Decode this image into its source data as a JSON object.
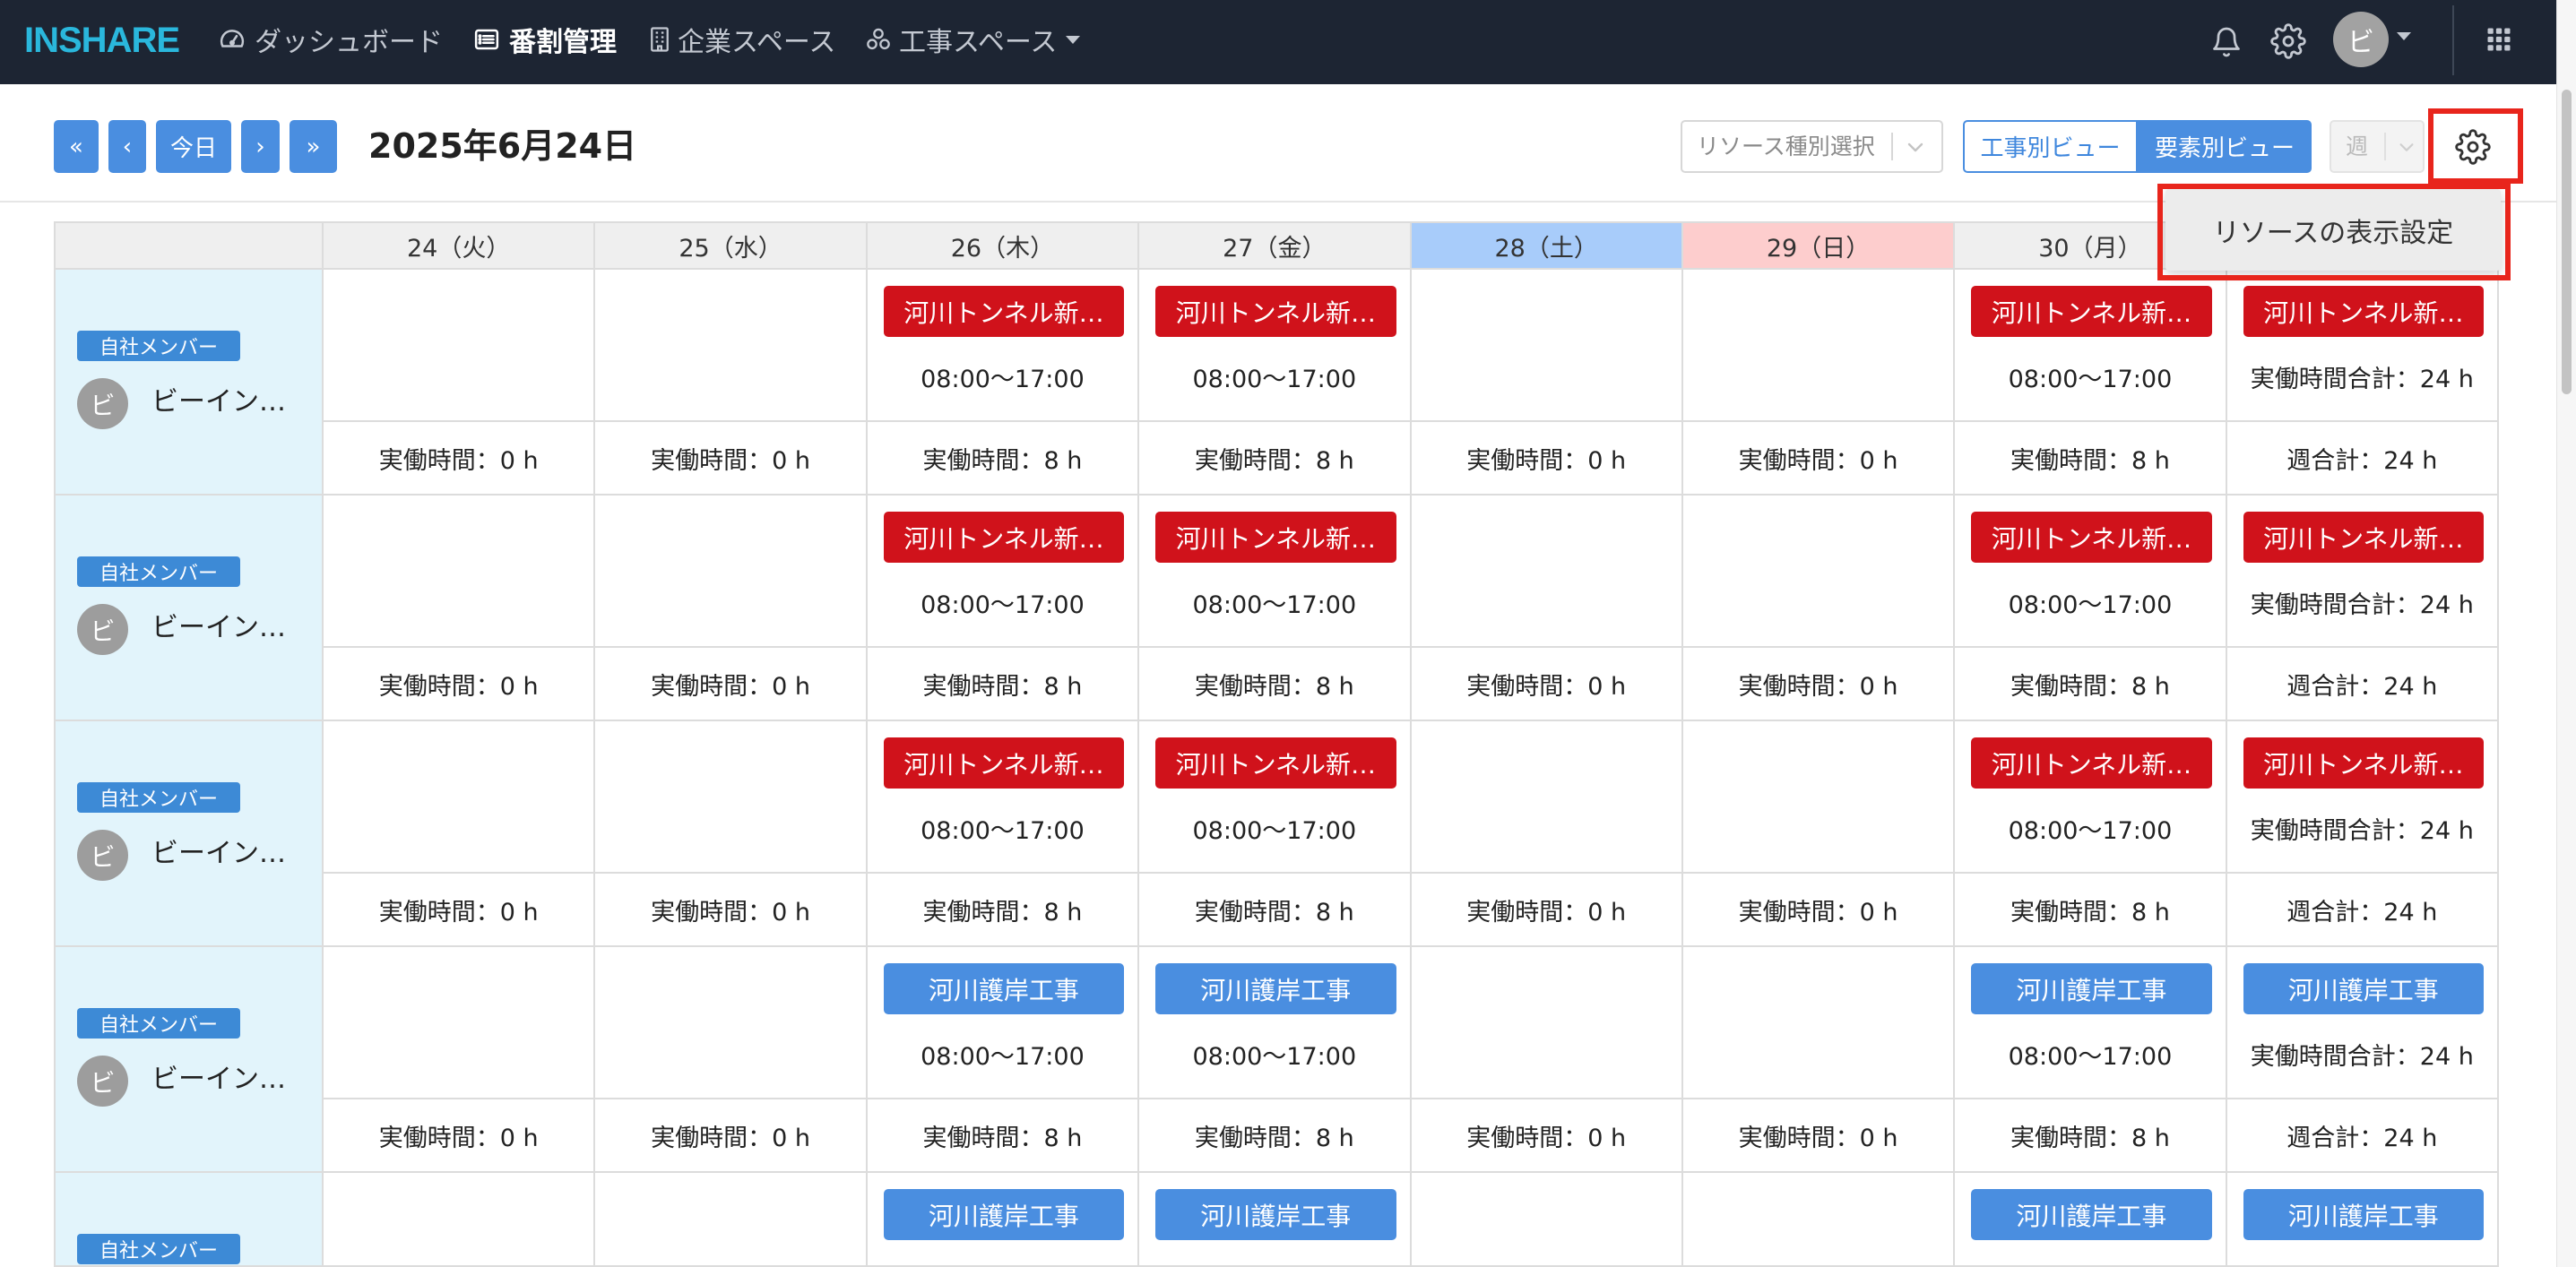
{
  "nav": {
    "logo": "INSHARE",
    "items": [
      {
        "label": "ダッシュボード",
        "icon": "dashboard-icon"
      },
      {
        "label": "番割管理",
        "icon": "list-icon",
        "active": true
      },
      {
        "label": "企業スペース",
        "icon": "building-icon"
      },
      {
        "label": "工事スペース",
        "icon": "network-icon",
        "has_dropdown": true
      }
    ],
    "right_icons": [
      "bell-icon",
      "gear-icon",
      "grid-icon"
    ],
    "avatar": "ビ"
  },
  "toolbar": {
    "first_label": "«",
    "prev_label": "‹",
    "today_label": "今日",
    "next_label": "›",
    "last_label": "»",
    "date_title": "2025年6月24日",
    "resource_type_placeholder": "リソース種別選択",
    "view_tabs": [
      {
        "label": "工事別ビュー",
        "selected": false
      },
      {
        "label": "要素別ビュー",
        "selected": true
      }
    ],
    "period_value": "週",
    "period_disabled": true,
    "settings_icon": "gear-icon"
  },
  "settings_menu": {
    "items": [
      "リソースの表示設定"
    ]
  },
  "colors": {
    "nav_bg": "#1d2533",
    "logo": "#2ab7dc",
    "primary": "#4a8ee0",
    "badge": "#3d8ad6",
    "event_red": "#d0121b",
    "event_blue": "#4a8ee0",
    "saturday": "#a8ccfa",
    "sunday": "#fdcdcd",
    "member_bg": "#e2f4fb",
    "highlight": "#e8251c"
  },
  "schedule": {
    "columns": [
      {
        "label": "24（火）"
      },
      {
        "label": "25（水）"
      },
      {
        "label": "26（木）"
      },
      {
        "label": "27（金）"
      },
      {
        "label": "28（土）",
        "highlight": "saturday"
      },
      {
        "label": "29（日）",
        "highlight": "sunday"
      },
      {
        "label": "30（月）"
      },
      {}
    ],
    "rows": [
      {
        "member": {
          "badge": "自社メンバー",
          "avatar": "ビ",
          "name": "ビーイン…"
        },
        "cells": [
          {
            "total": "実働時間：0 h"
          },
          {
            "total": "実働時間：0 h"
          },
          {
            "event": {
              "label": "河川トンネル新…",
              "color": "#d0121b"
            },
            "detail": "08:00〜17:00",
            "total": "実働時間：8 h"
          },
          {
            "event": {
              "label": "河川トンネル新…",
              "color": "#d0121b"
            },
            "detail": "08:00〜17:00",
            "total": "実働時間：8 h"
          },
          {
            "total": "実働時間：0 h"
          },
          {
            "total": "実働時間：0 h"
          },
          {
            "event": {
              "label": "河川トンネル新…",
              "color": "#d0121b"
            },
            "detail": "08:00〜17:00",
            "total": "実働時間：8 h"
          },
          {
            "event": {
              "label": "河川トンネル新…",
              "color": "#d0121b"
            },
            "detail": "実働時間合計：24 h",
            "total": "週合計：24 h"
          }
        ]
      },
      {
        "member": {
          "badge": "自社メンバー",
          "avatar": "ビ",
          "name": "ビーイン…"
        },
        "cells": [
          {
            "total": "実働時間：0 h"
          },
          {
            "total": "実働時間：0 h"
          },
          {
            "event": {
              "label": "河川トンネル新…",
              "color": "#d0121b"
            },
            "detail": "08:00〜17:00",
            "total": "実働時間：8 h"
          },
          {
            "event": {
              "label": "河川トンネル新…",
              "color": "#d0121b"
            },
            "detail": "08:00〜17:00",
            "total": "実働時間：8 h"
          },
          {
            "total": "実働時間：0 h"
          },
          {
            "total": "実働時間：0 h"
          },
          {
            "event": {
              "label": "河川トンネル新…",
              "color": "#d0121b"
            },
            "detail": "08:00〜17:00",
            "total": "実働時間：8 h"
          },
          {
            "event": {
              "label": "河川トンネル新…",
              "color": "#d0121b"
            },
            "detail": "実働時間合計：24 h",
            "total": "週合計：24 h"
          }
        ]
      },
      {
        "member": {
          "badge": "自社メンバー",
          "avatar": "ビ",
          "name": "ビーイン…"
        },
        "cells": [
          {
            "total": "実働時間：0 h"
          },
          {
            "total": "実働時間：0 h"
          },
          {
            "event": {
              "label": "河川トンネル新…",
              "color": "#d0121b"
            },
            "detail": "08:00〜17:00",
            "total": "実働時間：8 h"
          },
          {
            "event": {
              "label": "河川トンネル新…",
              "color": "#d0121b"
            },
            "detail": "08:00〜17:00",
            "total": "実働時間：8 h"
          },
          {
            "total": "実働時間：0 h"
          },
          {
            "total": "実働時間：0 h"
          },
          {
            "event": {
              "label": "河川トンネル新…",
              "color": "#d0121b"
            },
            "detail": "08:00〜17:00",
            "total": "実働時間：8 h"
          },
          {
            "event": {
              "label": "河川トンネル新…",
              "color": "#d0121b"
            },
            "detail": "実働時間合計：24 h",
            "total": "週合計：24 h"
          }
        ]
      },
      {
        "member": {
          "badge": "自社メンバー",
          "avatar": "ビ",
          "name": "ビーイン…"
        },
        "cells": [
          {
            "total": "実働時間：0 h"
          },
          {
            "total": "実働時間：0 h"
          },
          {
            "event": {
              "label": "河川護岸工事",
              "color": "#4a8ee0"
            },
            "detail": "08:00〜17:00",
            "total": "実働時間：8 h"
          },
          {
            "event": {
              "label": "河川護岸工事",
              "color": "#4a8ee0"
            },
            "detail": "08:00〜17:00",
            "total": "実働時間：8 h"
          },
          {
            "total": "実働時間：0 h"
          },
          {
            "total": "実働時間：0 h"
          },
          {
            "event": {
              "label": "河川護岸工事",
              "color": "#4a8ee0"
            },
            "detail": "08:00〜17:00",
            "total": "実働時間：8 h"
          },
          {
            "event": {
              "label": "河川護岸工事",
              "color": "#4a8ee0"
            },
            "detail": "実働時間合計：24 h",
            "total": "週合計：24 h"
          }
        ]
      },
      {
        "member": {
          "badge": "自社メンバー"
        },
        "cells": [
          {},
          {},
          {
            "event": {
              "label": "河川護岸工事",
              "color": "#4a8ee0"
            }
          },
          {
            "event": {
              "label": "河川護岸工事",
              "color": "#4a8ee0"
            }
          },
          {},
          {},
          {
            "event": {
              "label": "河川護岸工事",
              "color": "#4a8ee0"
            }
          },
          {
            "event": {
              "label": "河川護岸工事",
              "color": "#4a8ee0"
            }
          }
        ]
      }
    ]
  }
}
